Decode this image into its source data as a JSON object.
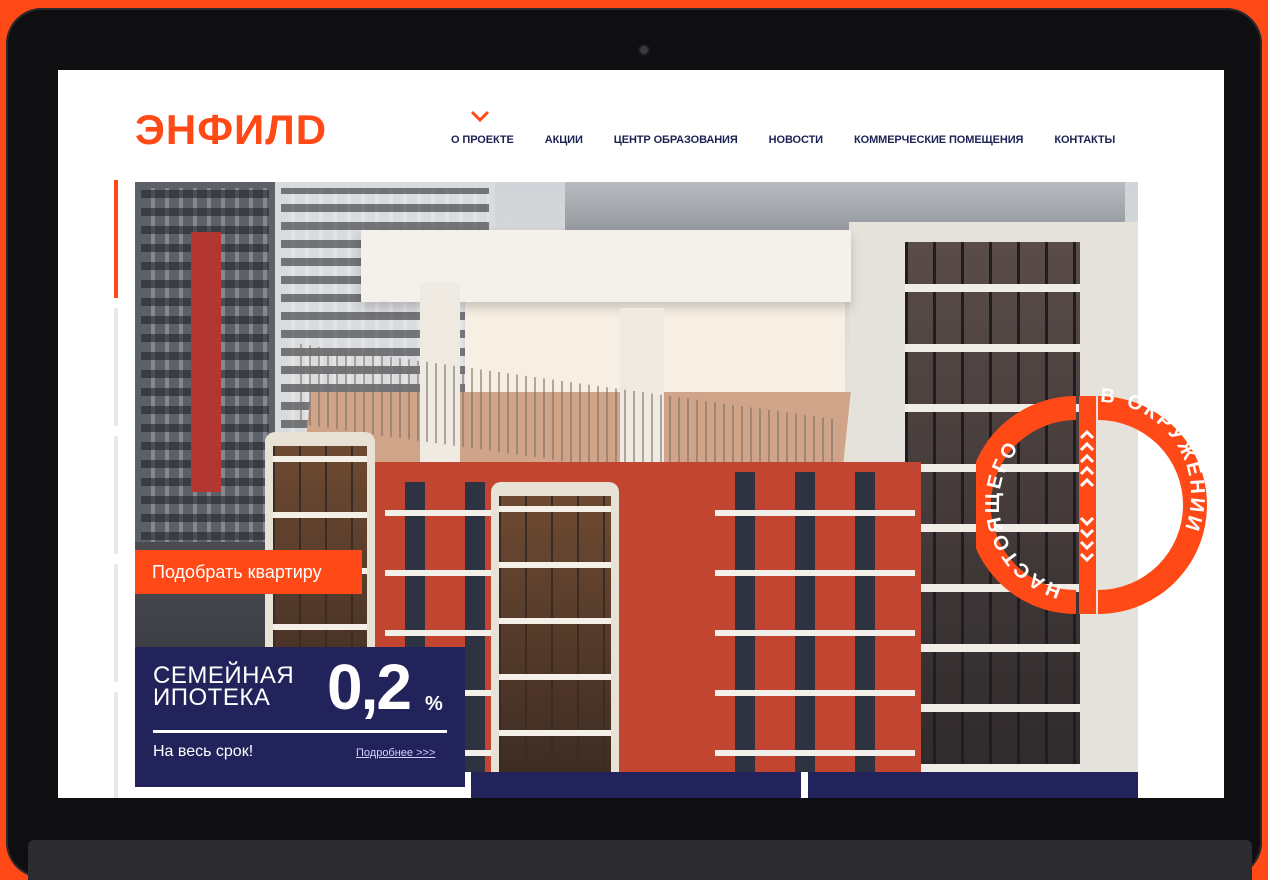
{
  "brand": {
    "logo": "ЭНФИЛD",
    "accent": "#ff4a17",
    "navy": "#23235b"
  },
  "nav": {
    "items": [
      {
        "label": "О ПРОЕКТЕ"
      },
      {
        "label": "АКЦИИ"
      },
      {
        "label": "ЦЕНТР ОБРАЗОВАНИЯ"
      },
      {
        "label": "НОВОСТИ"
      },
      {
        "label": "КОММЕРЧЕСКИЕ ПОМЕЩЕНИЯ"
      },
      {
        "label": "КОНТАКТЫ"
      }
    ],
    "active_icon": "chevron-down-icon"
  },
  "hero": {
    "cta_label": "Подобрать квартиру",
    "badge_text_left": "НАСТОЯЩЕГО",
    "badge_text_right": "В ОКРУЖЕНИИ"
  },
  "promo": {
    "title": "СЕМЕЙНАЯ ИПОТЕКА",
    "rate": "0,2",
    "rate_unit": "%",
    "subtitle": "На весь срок!",
    "more_link": "Подробнее >>>"
  }
}
